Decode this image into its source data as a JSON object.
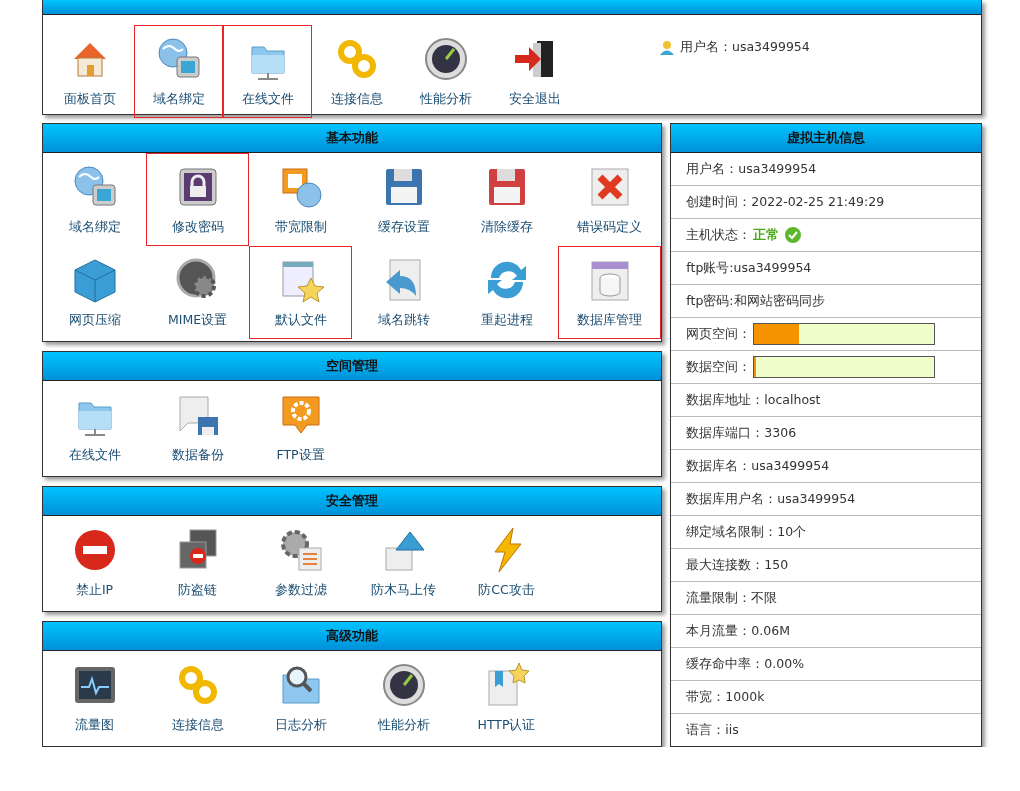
{
  "top_bar": {
    "items": [
      {
        "label": "面板首页",
        "highlighted": false
      },
      {
        "label": "域名绑定",
        "highlighted": true
      },
      {
        "label": "在线文件",
        "highlighted": true
      },
      {
        "label": "连接信息",
        "highlighted": false
      },
      {
        "label": "性能分析",
        "highlighted": false
      },
      {
        "label": "安全退出",
        "highlighted": false
      }
    ],
    "user": "用户名：usa3499954"
  },
  "sections": [
    {
      "title": "基本功能",
      "items": [
        {
          "label": "域名绑定",
          "highlighted": false
        },
        {
          "label": "修改密码",
          "highlighted": true
        },
        {
          "label": "带宽限制",
          "highlighted": false
        },
        {
          "label": "缓存设置",
          "highlighted": false
        },
        {
          "label": "清除缓存",
          "highlighted": false
        },
        {
          "label": "错误码定义",
          "highlighted": false
        },
        {
          "label": "网页压缩",
          "highlighted": false
        },
        {
          "label": "MIME设置",
          "highlighted": false
        },
        {
          "label": "默认文件",
          "highlighted": true
        },
        {
          "label": "域名跳转",
          "highlighted": false
        },
        {
          "label": "重起进程",
          "highlighted": false
        },
        {
          "label": "数据库管理",
          "highlighted": true
        }
      ]
    },
    {
      "title": "空间管理",
      "items": [
        {
          "label": "在线文件",
          "highlighted": false
        },
        {
          "label": "数据备份",
          "highlighted": false
        },
        {
          "label": "FTP设置",
          "highlighted": false
        }
      ]
    },
    {
      "title": "安全管理",
      "items": [
        {
          "label": "禁止IP",
          "highlighted": false
        },
        {
          "label": "防盗链",
          "highlighted": false
        },
        {
          "label": "参数过滤",
          "highlighted": false
        },
        {
          "label": "防木马上传",
          "highlighted": false
        },
        {
          "label": "防CC攻击",
          "highlighted": false
        }
      ]
    },
    {
      "title": "高级功能",
      "items": [
        {
          "label": "流量图",
          "highlighted": false
        },
        {
          "label": "连接信息",
          "highlighted": false
        },
        {
          "label": "日志分析",
          "highlighted": false
        },
        {
          "label": "性能分析",
          "highlighted": false
        },
        {
          "label": "HTTP认证",
          "highlighted": false
        }
      ]
    }
  ],
  "host_info": {
    "title": "虚拟主机信息",
    "rows": [
      {
        "kind": "text",
        "text": "用户名：usa3499954"
      },
      {
        "kind": "text",
        "text": "创建时间：2022-02-25 21:49:29"
      },
      {
        "kind": "status",
        "label": "主机状态：",
        "value": "正常"
      },
      {
        "kind": "text",
        "text": "ftp账号:usa3499954"
      },
      {
        "kind": "text",
        "text": "ftp密码:和网站密码同步"
      },
      {
        "kind": "meter",
        "label": "网页空间：",
        "level": 0.25
      },
      {
        "kind": "meter",
        "label": "数据空间：",
        "level": 0.01
      },
      {
        "kind": "text",
        "text": "数据库地址：localhost"
      },
      {
        "kind": "text",
        "text": "数据库端口：3306"
      },
      {
        "kind": "text",
        "text": "数据库名：usa3499954"
      },
      {
        "kind": "text",
        "text": "数据库用户名：usa3499954"
      },
      {
        "kind": "text",
        "text": "绑定域名限制：10个"
      },
      {
        "kind": "text",
        "text": "最大连接数：150"
      },
      {
        "kind": "text",
        "text": "流量限制：不限"
      },
      {
        "kind": "text",
        "text": "本月流量：0.06M"
      },
      {
        "kind": "text",
        "text": "缓存命中率：0.00%"
      },
      {
        "kind": "text",
        "text": "带宽：1000k"
      },
      {
        "kind": "text",
        "text": "语言：iis"
      }
    ]
  }
}
